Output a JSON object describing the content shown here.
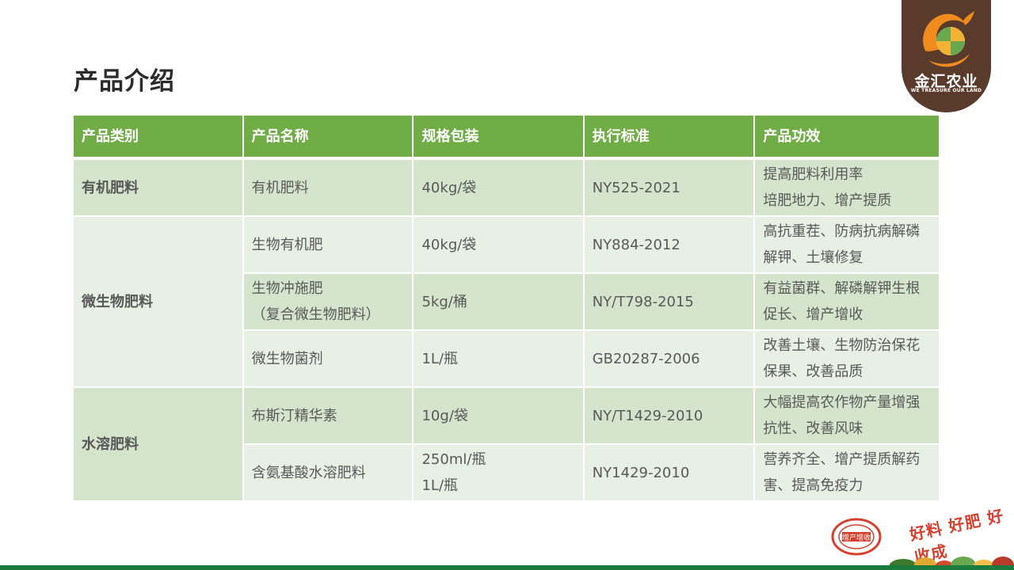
{
  "title": "产品介绍",
  "logo": {
    "name": "金汇农业",
    "slogan": "WE TREASURE OUR LAND",
    "colors": {
      "bg": "#5a3a2a",
      "orange": "#f08c1e",
      "green": "#6aa84f"
    }
  },
  "table": {
    "headers": [
      "产品类别",
      "产品名称",
      "规格包装",
      "执行标准",
      "产品功效"
    ],
    "categories": {
      "organic": "有机肥料",
      "microbial": "微生物肥料",
      "water_soluble": "水溶肥料"
    },
    "rows": [
      {
        "name": [
          "有机肥料"
        ],
        "spec": [
          "40kg/袋"
        ],
        "standard": "NY525-2021",
        "effect": [
          "提高肥料利用率",
          "培肥地力、增产提质"
        ]
      },
      {
        "name": [
          "生物有机肥"
        ],
        "spec": [
          "40kg/袋"
        ],
        "standard": "NY884-2012",
        "effect": [
          "高抗重茬、防病抗病解磷",
          "解钾、土壤修复"
        ]
      },
      {
        "name": [
          "生物冲施肥",
          "（复合微生物肥料）"
        ],
        "spec": [
          "5kg/桶"
        ],
        "standard": "NY/T798-2015",
        "effect": [
          "有益菌群、解磷解钾生根",
          "促长、增产增收"
        ]
      },
      {
        "name": [
          "微生物菌剂"
        ],
        "spec": [
          "1L/瓶"
        ],
        "standard": "GB20287-2006",
        "effect": [
          "改善土壤、生物防治保花",
          "保果、改善品质"
        ]
      },
      {
        "name": [
          "布斯汀精华素"
        ],
        "spec": [
          "10g/袋"
        ],
        "standard": "NY/T1429-2010",
        "effect": [
          "大幅提高农作物产量增强",
          "抗性、改善风味"
        ]
      },
      {
        "name": [
          "含氨基酸水溶肥料"
        ],
        "spec": [
          "250ml/瓶",
          "1L/瓶"
        ],
        "standard": "NY1429-2010",
        "effect": [
          "营养齐全、增产提质解药",
          "害、提高免疫力"
        ]
      }
    ],
    "colors": {
      "header": "#70ad47",
      "band_dark": "#d5e4cd",
      "band_light": "#e8efe5"
    }
  },
  "decor": {
    "slogan": "好料 好肥 好收成",
    "stamp_text": "增产增收"
  }
}
